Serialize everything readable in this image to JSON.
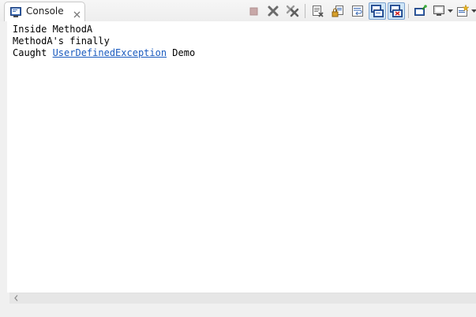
{
  "tab": {
    "title": "Console",
    "icon": "console-icon",
    "close_icon": "close-icon"
  },
  "toolbar": {
    "buttons": [
      {
        "name": "terminate-button",
        "icon": "stop-square-icon",
        "state": "disabled"
      },
      {
        "name": "remove-launch-button",
        "icon": "gray-x-icon"
      },
      {
        "name": "remove-all-terminated-button",
        "icon": "double-gray-x-icon"
      },
      {
        "name": "clear-console-button",
        "icon": "clear-console-icon"
      },
      {
        "name": "scroll-lock-button",
        "icon": "scroll-lock-icon"
      },
      {
        "name": "word-wrap-button",
        "icon": "word-wrap-icon"
      },
      {
        "name": "show-on-stdout-button",
        "icon": "show-console-stdout-icon",
        "state": "pressed"
      },
      {
        "name": "show-on-stderr-button",
        "icon": "show-console-stderr-icon",
        "state": "pressed"
      },
      {
        "name": "pin-console-button",
        "icon": "pin-console-icon"
      },
      {
        "name": "display-selected-console-button",
        "icon": "monitor-icon"
      },
      {
        "name": "open-console-button",
        "icon": "new-console-icon"
      }
    ]
  },
  "colors": {
    "link": "#1a5bbf",
    "pressed_bg": "#cfe6f8",
    "pressed_border": "#7da2ce",
    "content_bg": "#ffffff",
    "chrome_bg": "#f0f0f0"
  },
  "console": {
    "lines": [
      {
        "text": "Inside MethodA"
      },
      {
        "text": "MethodA's finally"
      },
      {
        "prefix": "Caught ",
        "link": "UserDefinedException",
        "suffix": " Demo"
      }
    ]
  },
  "scrollbar": {
    "left_arrow_icon": "chevron-left-icon"
  }
}
